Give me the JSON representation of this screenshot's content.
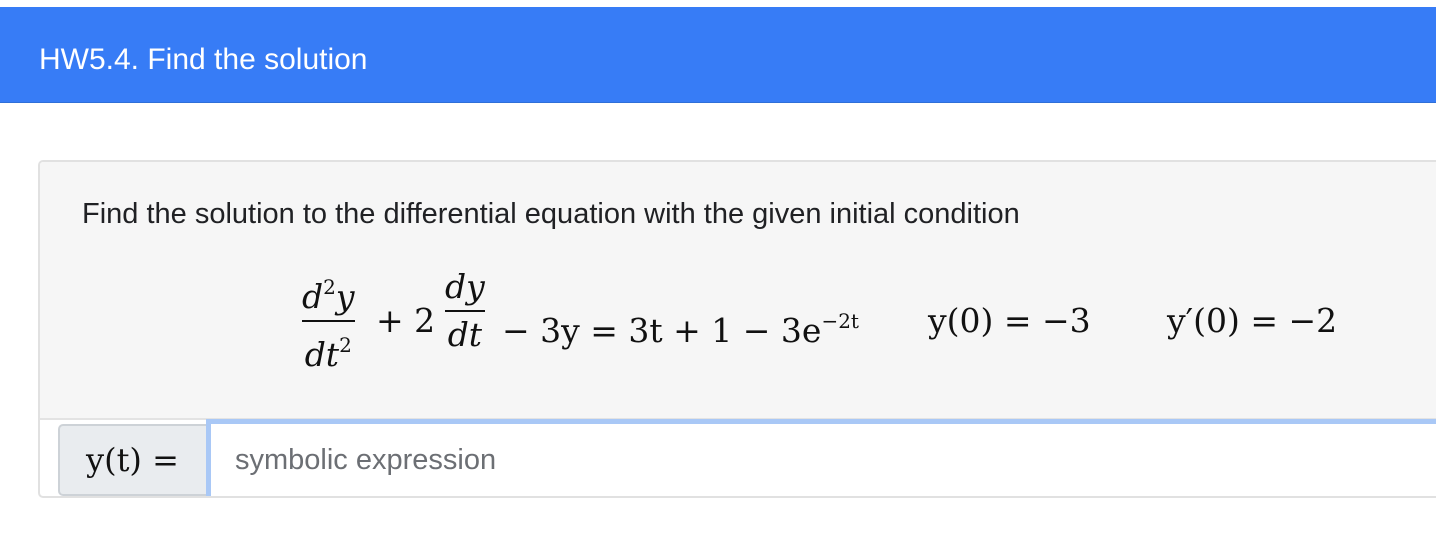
{
  "header": {
    "title": "HW5.4. Find the solution"
  },
  "question": {
    "prompt": "Find the solution to the differential equation with the given initial condition",
    "equation": {
      "term1_num": "d",
      "term1_num_sup": "2",
      "term1_num_var": "y",
      "term1_den": "dt",
      "term1_den_sup": "2",
      "plus_two": "+ 2",
      "term2_num": "dy",
      "term2_den": "dt",
      "rhs": "− 3y = 3t + 1 − 3e",
      "rhs_exp": "−2t",
      "condition1": "y(0) = −3",
      "condition2": "y′(0) = −2"
    },
    "answer": {
      "label": "y(t) =",
      "placeholder": "symbolic expression",
      "value": ""
    }
  },
  "colors": {
    "header_bg": "#377cf6",
    "card_body_bg": "#f6f6f6",
    "input_focus_border": "#a9c8f6",
    "addon_bg": "#e9ecef"
  }
}
